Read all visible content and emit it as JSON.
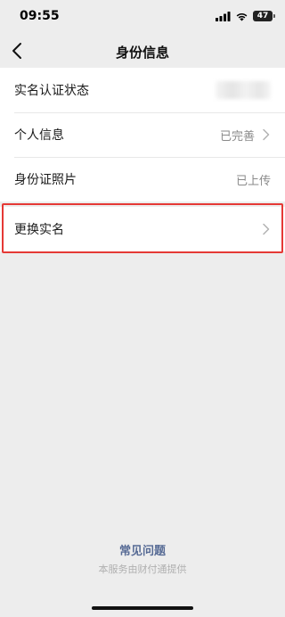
{
  "status_bar": {
    "time": "09:55",
    "battery": "47",
    "icons": [
      "signal-icon",
      "wifi-icon",
      "battery-icon"
    ]
  },
  "nav": {
    "title": "身份信息",
    "back_icon": "chevron-left-icon"
  },
  "items": [
    {
      "label": "实名认证状态"
    },
    {
      "label": "个人信息",
      "value": "已完善"
    },
    {
      "label": "身份证照片",
      "value": "已上传"
    }
  ],
  "change_name": {
    "label": "更换实名"
  },
  "footer": {
    "faq": "常见问题",
    "note": "本服务由财付通提供"
  },
  "colors": {
    "background": "#ededed",
    "link": "#576b95",
    "highlight": "#e53935"
  }
}
